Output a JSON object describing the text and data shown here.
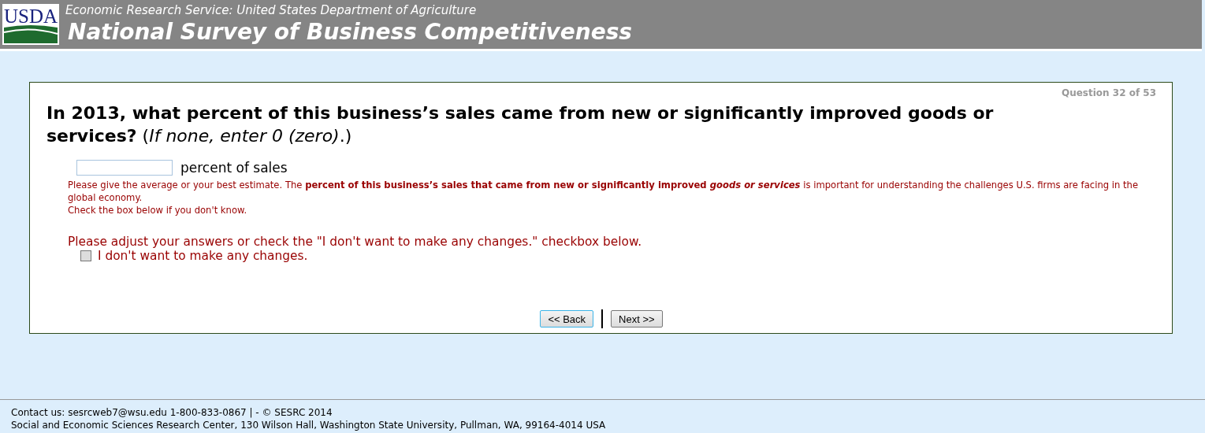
{
  "header": {
    "logo_text": "USDA",
    "agency": "Economic Research Service: United States Department of Agriculture",
    "title": "National Survey of Business Competitiveness"
  },
  "question": {
    "counter": "Question 32 of 53",
    "text": "In 2013, what percent of this business’s sales came from new or significantly improved goods or services?",
    "hint": "(*If none, enter 0 (zero)*.)"
  },
  "answer": {
    "unit": "percent of sales"
  },
  "help": {
    "lead": "Please give the average or your best estimate. The",
    "emphasis": "percent of this business’s sales that came from new or significantly improved",
    "emphasis_italic": "goods or services",
    "tail": "is important for understanding the challenges U.S. firms are facing in the global economy.",
    "note": "Check the box below if you don't know."
  },
  "validation": "Please adjust your answers or check the \"I don't want to make any changes.\" checkbox below.",
  "checkbox": {
    "label": "I don't want to make any changes.",
    "checked": false
  },
  "buttons": [
    {
      "label": "<< Back",
      "focused": true
    },
    {
      "label": "Next >>",
      "focused": false
    }
  ],
  "footer": [
    "Contact us: sesrcweb7@wsu.edu 1-800-833-0867 | - © SESRC 2014",
    "Social and Economic Sciences Research Center, 130 Wilson Hall, Washington State University, Pullman, WA, 99164-4014 USA"
  ]
}
